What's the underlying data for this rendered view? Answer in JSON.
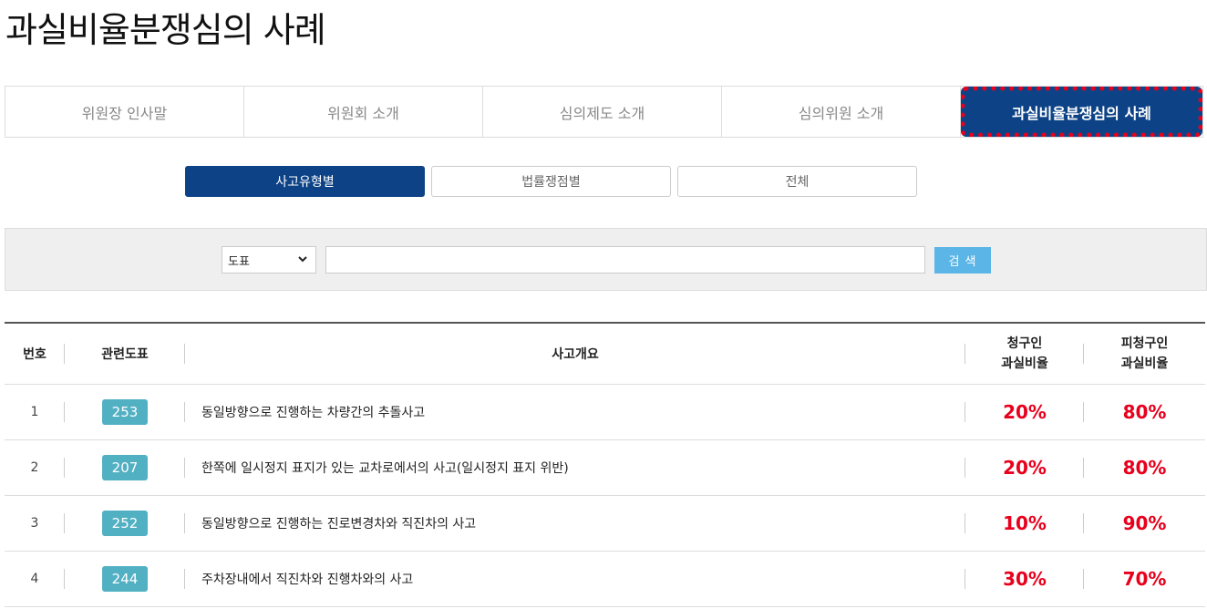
{
  "page_title": "과실비율분쟁심의 사례",
  "main_tabs": [
    {
      "label": "위원장 인사말"
    },
    {
      "label": "위원회 소개"
    },
    {
      "label": "심의제도 소개"
    },
    {
      "label": "심의위원 소개"
    },
    {
      "label": "과실비율분쟁심의 사례"
    }
  ],
  "sub_tabs": [
    {
      "label": "사고유형별"
    },
    {
      "label": "법률쟁점별"
    },
    {
      "label": "전체"
    }
  ],
  "search": {
    "select_value": "도표",
    "input_value": "",
    "button_label": "검 색"
  },
  "table": {
    "headers": {
      "no": "번호",
      "figure": "관련도표",
      "summary": "사고개요",
      "claimant": "청구인\n과실비율",
      "respondent": "피청구인\n과실비율"
    },
    "rows": [
      {
        "no": "1",
        "figure": "253",
        "summary": "동일방향으로 진행하는 차량간의 추돌사고",
        "claimant": "20%",
        "respondent": "80%"
      },
      {
        "no": "2",
        "figure": "207",
        "summary": "한쪽에 일시정지 표지가 있는 교차로에서의 사고(일시정지 표지 위반)",
        "claimant": "20%",
        "respondent": "80%"
      },
      {
        "no": "3",
        "figure": "252",
        "summary": "동일방향으로 진행하는 진로변경차와 직진차의 사고",
        "claimant": "10%",
        "respondent": "90%"
      },
      {
        "no": "4",
        "figure": "244",
        "summary": "주차장내에서 직진차와 진행차와의 사고",
        "claimant": "30%",
        "respondent": "70%"
      }
    ]
  }
}
